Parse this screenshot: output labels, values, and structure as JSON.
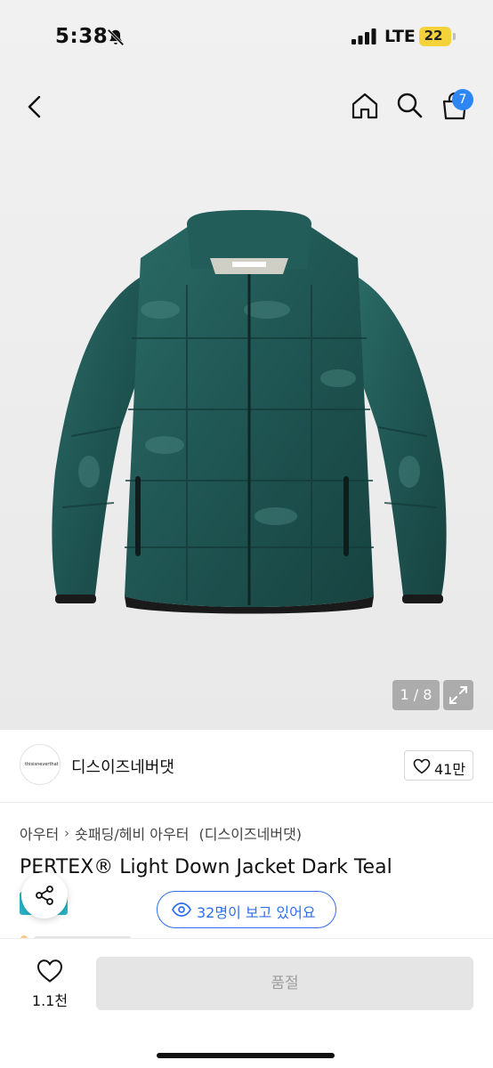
{
  "status_bar": {
    "time": "5:38",
    "network": "LTE",
    "battery": "22",
    "icons": [
      "bell-off-icon",
      "signal-icon",
      "battery-icon"
    ]
  },
  "nav": {
    "cart_count": "7",
    "icons": [
      "chevron-left-icon",
      "home-icon",
      "search-icon",
      "cart-icon"
    ]
  },
  "gallery": {
    "pager": "1 / 8",
    "icons": [
      "expand-icon"
    ]
  },
  "shop": {
    "logo_text": "thisisneverthat",
    "name": "디스이즈네버댓",
    "likes": "41만"
  },
  "breadcrumb": {
    "items": [
      "아우터",
      "숏패딩/헤비 아우터",
      "(디스이즈네버댓)"
    ]
  },
  "product": {
    "title": "PERTEX® Light Down Jacket Dark Teal"
  },
  "viewers": {
    "text": "32명이 보고 있어요"
  },
  "bottom": {
    "wish_count": "1.1천",
    "soldout_label": "품절"
  },
  "colors": {
    "accent_blue": "#2f6fed",
    "badge_blue": "#2e86f3",
    "battery_yellow": "#f3d23a",
    "jacket_teal": "#1f5552",
    "chip_teal": "#29b4c8",
    "soldout_bg": "#e5e5e5"
  }
}
